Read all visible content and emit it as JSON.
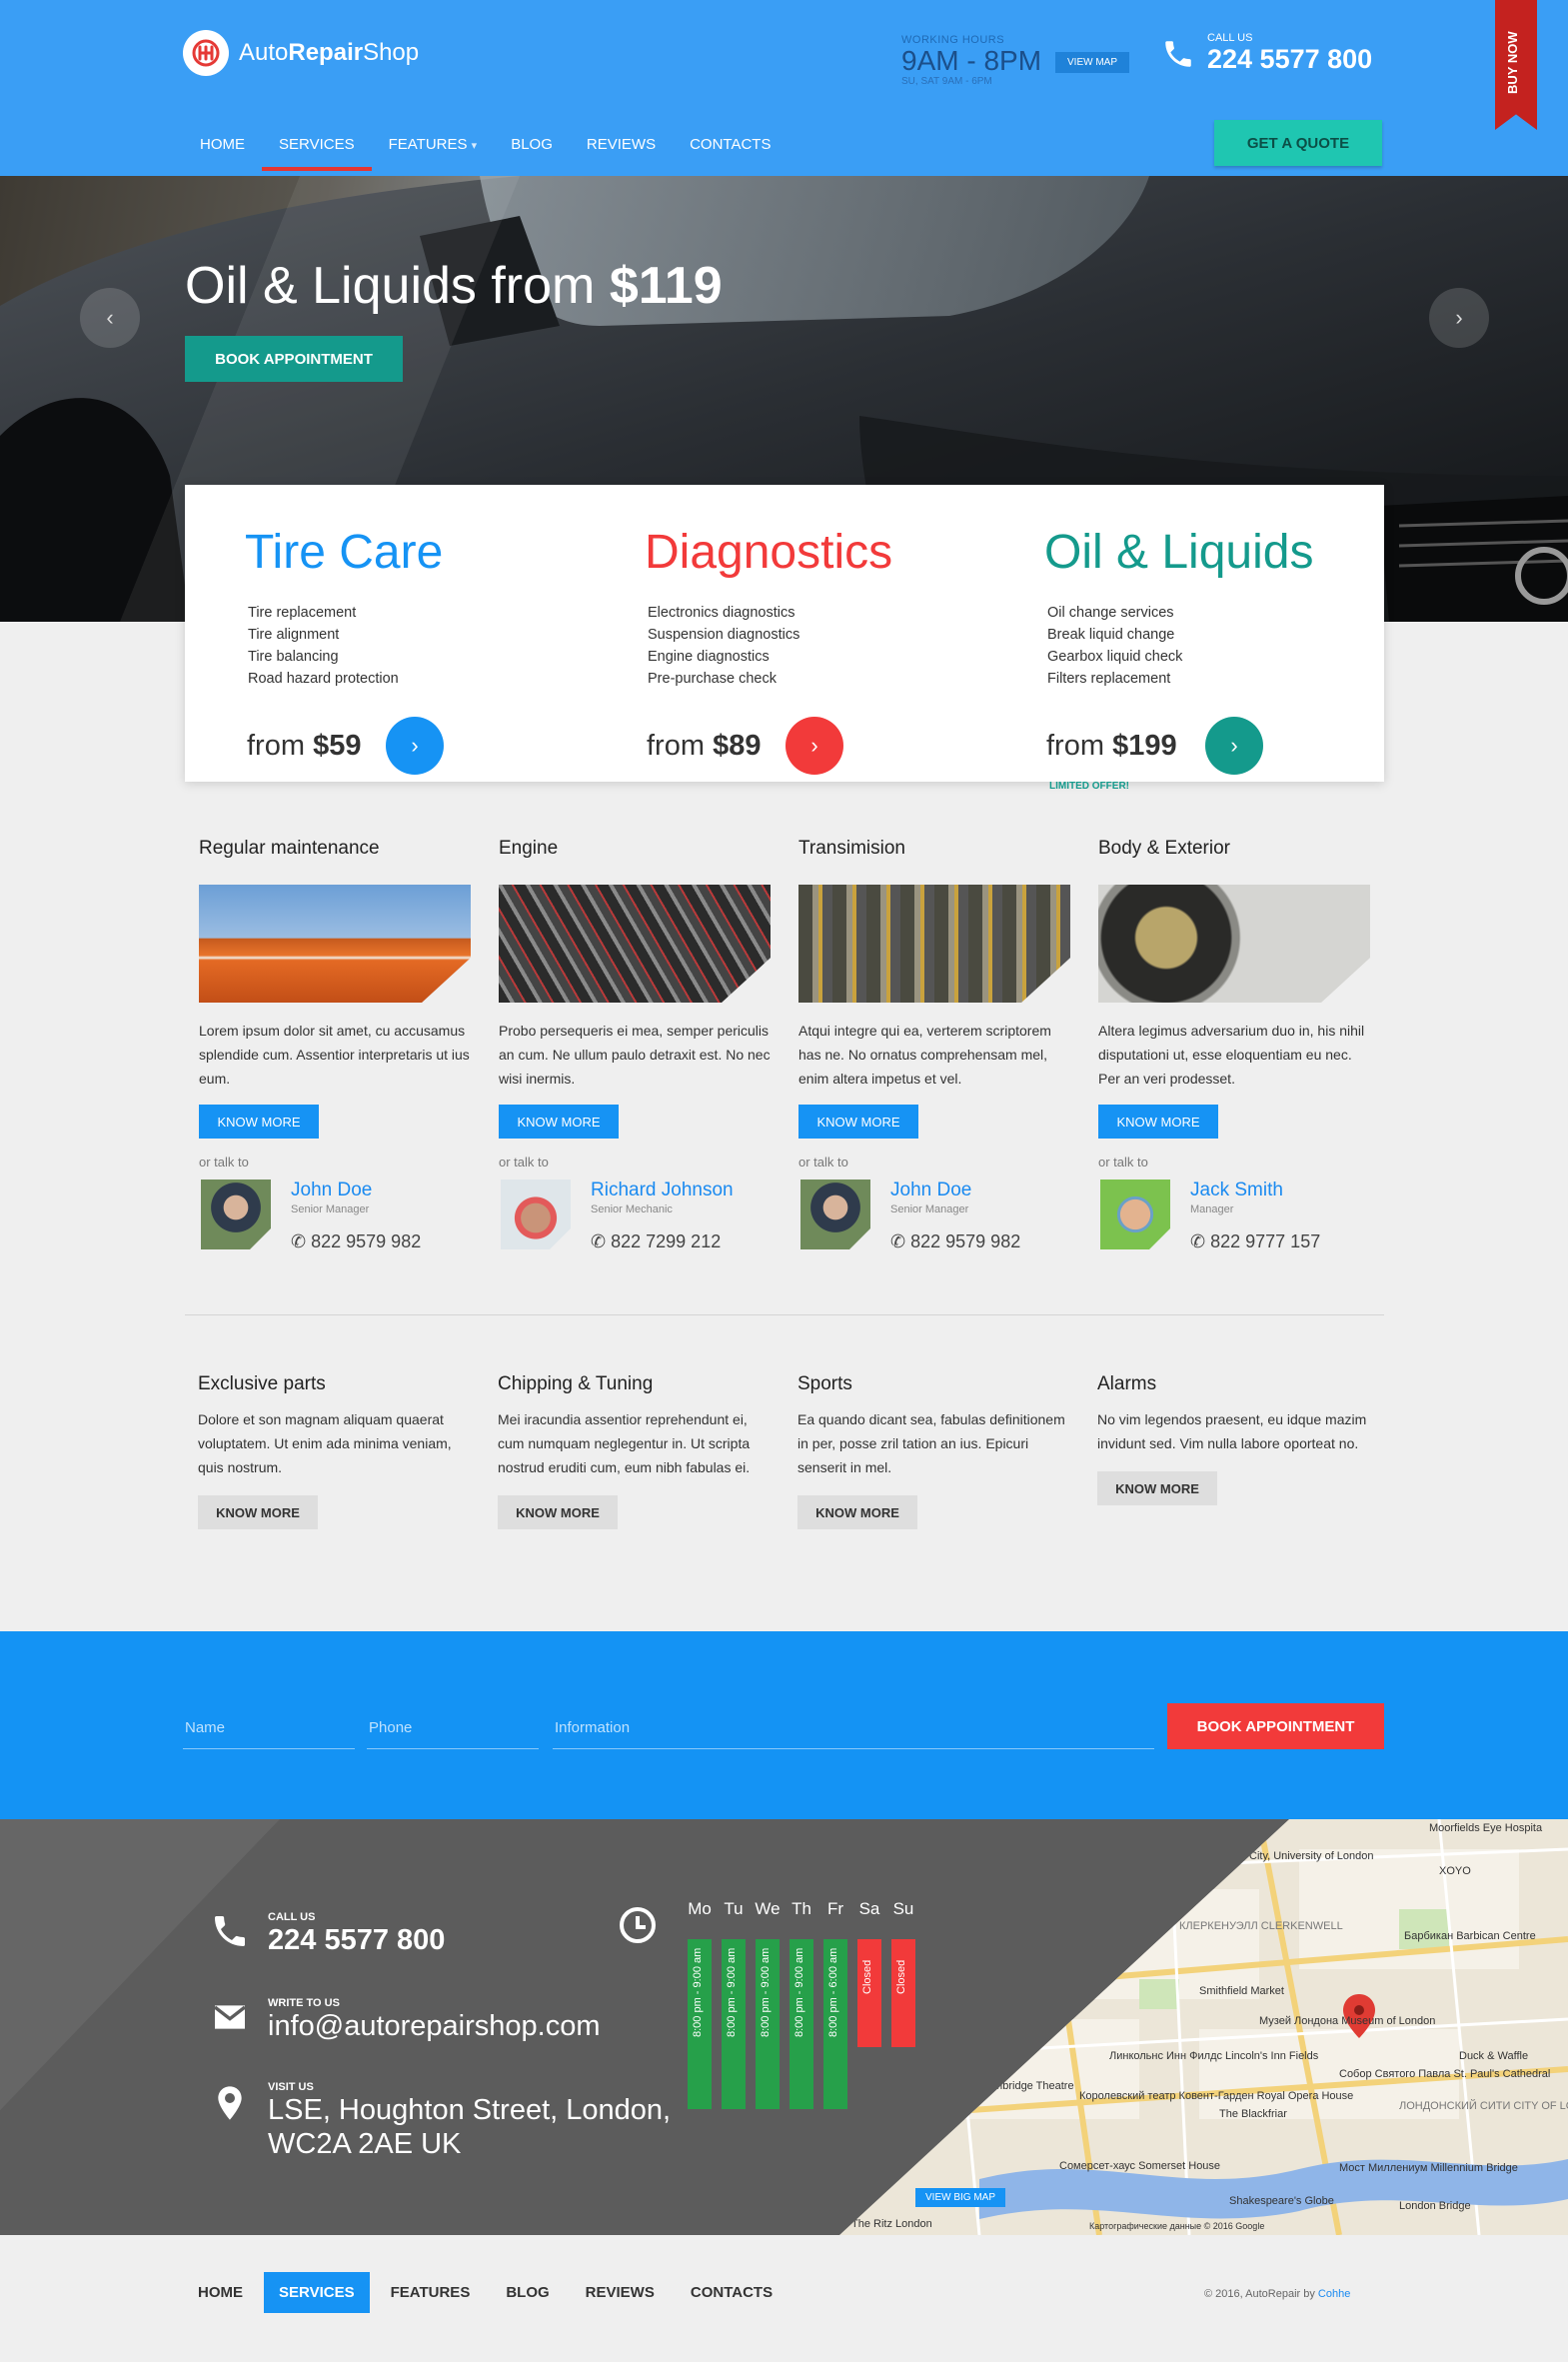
{
  "header": {
    "logo_text_light": "Auto",
    "logo_text_bold": "Repair",
    "logo_text_end": "Shop",
    "working_hours_label": "WORKING HOURS",
    "working_hours": "9AM - 8PM",
    "working_hours_weekend": "SU, SAT 9AM - 6PM",
    "view_map": "VIEW MAP",
    "call_label": "CALL US",
    "phone": "224 5577 800",
    "buy_now": "BUY NOW",
    "get_quote": "GET A QUOTE",
    "nav": [
      "HOME",
      "SERVICES",
      "FEATURES",
      "BLOG",
      "REVIEWS",
      "CONTACTS"
    ],
    "features_arrow": "▾"
  },
  "hero": {
    "title": "Oil & Liquids from ",
    "price": "$119",
    "book": "BOOK APPOINTMENT",
    "prev": "‹",
    "next": "›"
  },
  "services": [
    {
      "title": "Tire Care",
      "color": "#1693f4",
      "items": [
        "Tire replacement",
        "Tire alignment",
        "Tire balancing",
        "Road hazard protection"
      ],
      "from": "from ",
      "price": "$59",
      "note": ""
    },
    {
      "title": "Diagnostics",
      "color": "#f23a3a",
      "items": [
        "Electronics diagnostics",
        "Suspension diagnostics",
        "Engine diagnostics",
        "Pre-purchase check"
      ],
      "from": "from ",
      "price": "$89",
      "note": ""
    },
    {
      "title": "Oil & Liquids",
      "color": "#149a8c",
      "items": [
        "Oil change services",
        "Break liquid change",
        "Gearbox liquid check",
        "Filters replacement"
      ],
      "from": "from ",
      "price": "$199",
      "note": "LIMITED OFFER!"
    }
  ],
  "features": [
    {
      "title": "Regular maintenance",
      "text": "Lorem ipsum dolor sit amet, cu accusamus splendide cum. Assentior interpretaris ut ius eum.",
      "button": "KNOW MORE",
      "talk": "or talk to",
      "name": "John Doe",
      "role": "Senior Manager",
      "phone": "822 9579 982"
    },
    {
      "title": "Engine",
      "text": "Probo persequeris ei mea, semper periculis an cum. Ne ullum paulo detraxit est. No nec wisi inermis.",
      "button": "KNOW MORE",
      "talk": "or talk to",
      "name": "Richard Johnson",
      "role": "Senior Mechanic",
      "phone": "822 7299 212"
    },
    {
      "title": "Transimision",
      "text": "Atqui integre qui ea, verterem scriptorem has ne. No ornatus comprehensam mel, enim altera impetus et vel.",
      "button": "KNOW MORE",
      "talk": "or talk to",
      "name": "John Doe",
      "role": "Senior Manager",
      "phone": "822 9579 982"
    },
    {
      "title": "Body & Exterior",
      "text": "Altera legimus adversarium duo in, his nihil disputationi ut, esse eloquentiam eu nec. Per an veri prodesset.",
      "button": "KNOW MORE",
      "talk": "or talk to",
      "name": "Jack Smith",
      "role": "Manager",
      "phone": "822 9777 157"
    }
  ],
  "extras": [
    {
      "title": "Exclusive parts",
      "text": "Dolore et son magnam aliquam quaerat voluptatem. Ut enim ada minima veniam, quis nostrum.",
      "button": "KNOW MORE"
    },
    {
      "title": "Chipping & Tuning",
      "text": "Mei iracundia assentior reprehendunt ei, cum numquam neglegentur in. Ut scripta nostrud eruditi cum, eum nibh fabulas ei.",
      "button": "KNOW MORE"
    },
    {
      "title": "Sports",
      "text": "Ea quando dicant sea, fabulas definitionem in per, posse zril tation an ius. Epicuri senserit in mel.",
      "button": "KNOW MORE"
    },
    {
      "title": "Alarms",
      "text": "No vim legendos praesent, eu idque mazim invidunt sed. Vim nulla labore oporteat no.",
      "button": "KNOW MORE"
    }
  ],
  "form": {
    "name_placeholder": "Name",
    "phone_placeholder": "Phone",
    "info_placeholder": "Information",
    "submit": "BOOK APPOINTMENT"
  },
  "footer": {
    "call_label": "CALL US",
    "phone": "224 5577 800",
    "write_label": "WRITE TO US",
    "email": "info@autorepairshop.com",
    "visit_label": "VISIT US",
    "address_line1": "LSE, Houghton Street, London,",
    "address_line2": "WC2A 2AE UK",
    "days": [
      "Mo",
      "Tu",
      "We",
      "Th",
      "Fr",
      "Sa",
      "Su"
    ],
    "hours": [
      "8:00 pm - 9:00 am",
      "8:00 pm - 9:00 am",
      "8:00 pm - 9:00 am",
      "8:00 pm - 9:00 am",
      "8:00 pm - 6:00 am",
      "Closed",
      "Closed"
    ],
    "view_big_map": "VIEW BIG MAP",
    "map_labels": [
      "Moorfields Eye Hospita",
      "City, University of London",
      "XOYO",
      "КЛЕРКЕНУЭЛЛ CLERKENWELL",
      "Барбикан Barbican Centre",
      "Smithfield Market",
      "Музей Лондона Museum of London",
      "Duck & Waffle",
      "Линкольнс Инн Филдс Lincoln's Inn Fields",
      "Собор Святого Павла St. Paul's Cathedral",
      "Королевский театр Ковент-Гарден Royal Opera House",
      "The Blackfriar",
      "ЛОНДОНСКИЙ СИТИ CITY OF LONDON",
      "Cambridge Theatre",
      "Сомерсет-хаус Somerset House",
      "Мост Миллениум Millennium Bridge",
      "Shakespeare's Globe",
      "London Bridge",
      "The Ritz London",
      "Картографические данные © 2016 Google"
    ]
  },
  "bottom": {
    "nav": [
      "HOME",
      "SERVICES",
      "FEATURES",
      "BLOG",
      "REVIEWS",
      "CONTACTS"
    ],
    "copyright": "© 2016, AutoRepair by ",
    "author": "Cohhe"
  }
}
